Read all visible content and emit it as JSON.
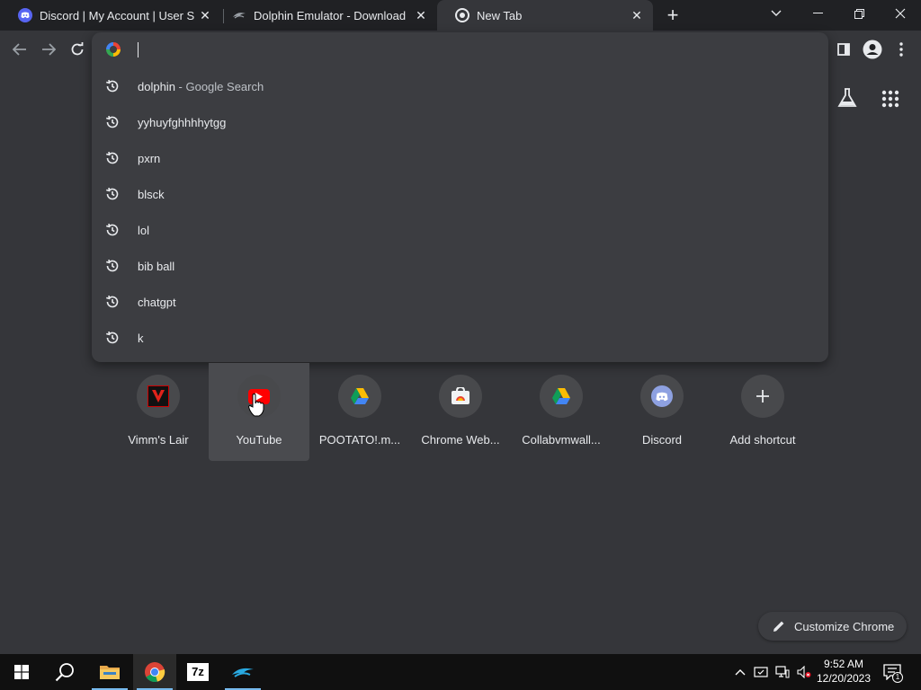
{
  "tabs": [
    {
      "title": "Discord | My Account | User Settings",
      "icon": "discord-icon",
      "icon_color": "#5865f2"
    },
    {
      "title": "Dolphin Emulator - Download",
      "icon": "dolphin-icon"
    },
    {
      "title": "New Tab",
      "icon": "chrome-icon",
      "active": true
    }
  ],
  "omnibox": {
    "value": "",
    "suggestions": [
      {
        "text": "dolphin",
        "description": " - Google Search"
      },
      {
        "text": "yyhuyfghhhhytgg",
        "description": ""
      },
      {
        "text": "pxrn",
        "description": ""
      },
      {
        "text": "blsck",
        "description": ""
      },
      {
        "text": "lol",
        "description": ""
      },
      {
        "text": "bib ball",
        "description": ""
      },
      {
        "text": "chatgpt",
        "description": ""
      },
      {
        "text": "k",
        "description": ""
      }
    ]
  },
  "shortcuts": [
    {
      "label": "Vimm's Lair",
      "icon": "vimms-lair-icon"
    },
    {
      "label": "YouTube",
      "icon": "youtube-icon"
    },
    {
      "label": "POOTATO!.m...",
      "icon": "google-drive-icon"
    },
    {
      "label": "Chrome Web...",
      "icon": "chrome-web-store-icon"
    },
    {
      "label": "Collabvmwall...",
      "icon": "google-drive-icon"
    },
    {
      "label": "Discord",
      "icon": "discord-icon"
    },
    {
      "label": "Add shortcut",
      "icon": "plus-icon"
    }
  ],
  "customize_label": "Customize Chrome",
  "taskbar": {
    "time": "9:52 AM",
    "date": "12/20/2023",
    "notification_count": "1"
  },
  "colors": {
    "page_bg": "#35363a",
    "tabstrip_bg": "#202124",
    "dropdown_bg": "#3c3d41",
    "taskbar_bg": "#101010",
    "accent_blue": "#76b9ed"
  }
}
